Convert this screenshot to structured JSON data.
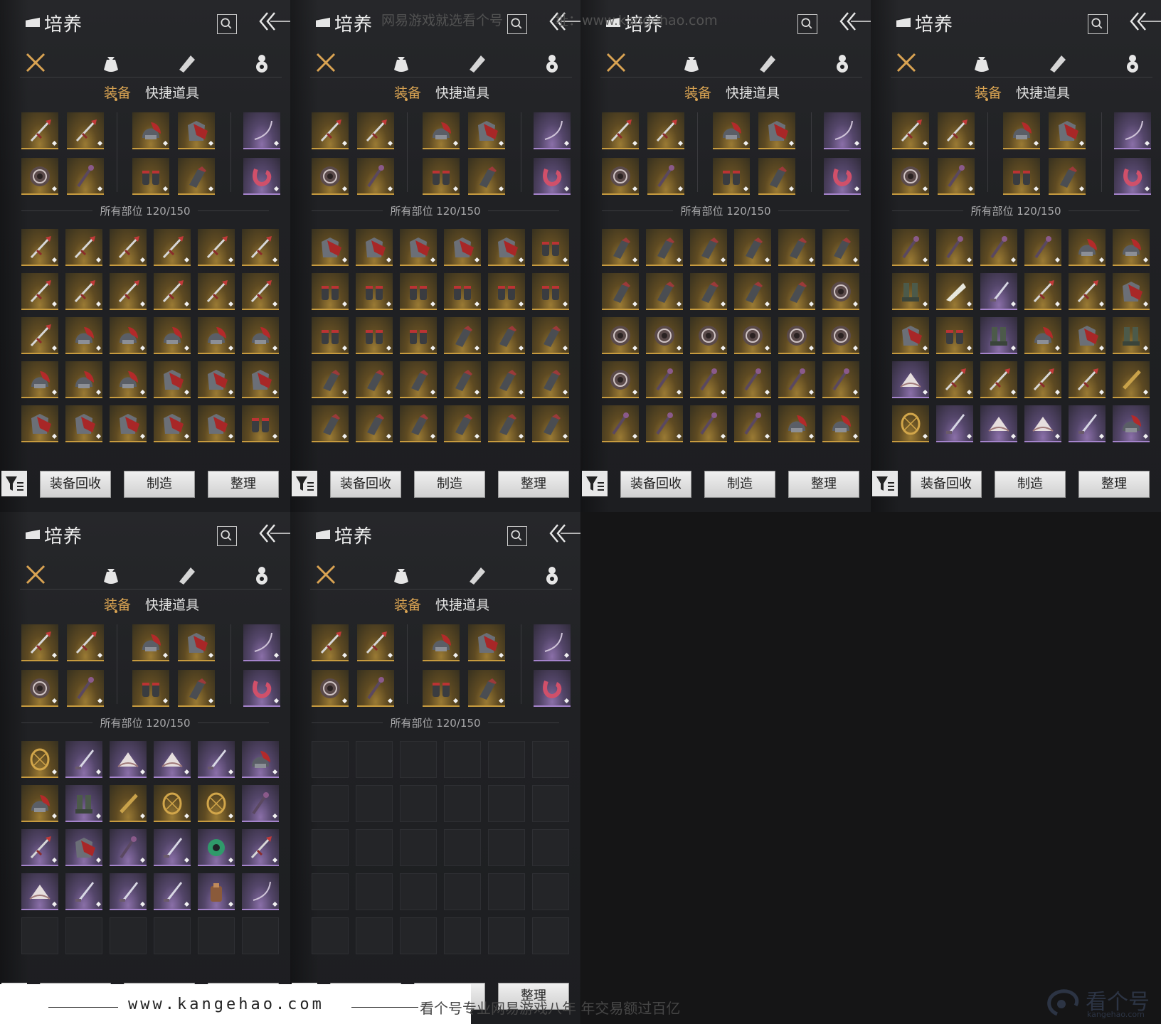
{
  "window_title": "培养",
  "sub_tabs": {
    "active": "装备",
    "inactive": "快捷道具"
  },
  "slot_count": "所有部位 120/150",
  "buttons": {
    "recycle": "装备回收",
    "craft": "制造",
    "sort": "整理"
  },
  "icons": {
    "categories": [
      "crossed-swords-icon",
      "pouch-icon",
      "scroll-icon",
      "gourd-icon"
    ],
    "search": "search-icon",
    "collapse": "collapse-arrow-icon",
    "filter": "filter-icon"
  },
  "top_watermark": {
    "left": "网易游戏就选看个号",
    "right": "址：www.kangehao.com"
  },
  "footer": {
    "url": "www.kangehao.com",
    "slogan": "看个号专业网易游戏八年   年交易额过百亿",
    "brand": "看个号",
    "brand_sub": "kangehao.com"
  },
  "colors": {
    "accent": "#d9a352",
    "gold_rarity": "#c79b3f",
    "purple_rarity": "#a584cc",
    "background": "#151516"
  },
  "panels": [
    {
      "id": "p1",
      "rows": [
        [
          "gold-spear",
          "gold-spear",
          "gold-spear",
          "gold-spear",
          "gold-spear",
          "gold-spear"
        ],
        [
          "gold-spear",
          "gold-spear",
          "gold-spear",
          "gold-spear",
          "gold-spear",
          "gold-spear"
        ],
        [
          "gold-spear",
          "gold-helmet",
          "gold-helmet",
          "gold-helmet",
          "gold-helmet",
          "gold-helmet"
        ],
        [
          "gold-helmet",
          "gold-helmet",
          "gold-helmet",
          "gold-armor",
          "gold-armor",
          "gold-armor"
        ],
        [
          "gold-armor",
          "gold-armor",
          "gold-armor",
          "gold-armor",
          "gold-armor",
          "gold-gloves"
        ]
      ]
    },
    {
      "id": "p2",
      "rows": [
        [
          "gold-armor",
          "gold-armor",
          "gold-armor",
          "gold-armor",
          "gold-armor",
          "gold-gloves"
        ],
        [
          "gold-gloves",
          "gold-gloves",
          "gold-gloves",
          "gold-gloves",
          "gold-gloves",
          "gold-gloves"
        ],
        [
          "gold-gloves",
          "gold-gloves",
          "gold-gloves",
          "gold-gauntlet",
          "gold-gauntlet",
          "gold-gauntlet"
        ],
        [
          "gold-gauntlet",
          "gold-gauntlet",
          "gold-gauntlet",
          "gold-gauntlet",
          "gold-gauntlet",
          "gold-gauntlet"
        ],
        [
          "gold-gauntlet",
          "gold-gauntlet",
          "gold-gauntlet",
          "gold-gauntlet",
          "gold-gauntlet",
          "gold-gauntlet"
        ]
      ]
    },
    {
      "id": "p3",
      "rows": [
        [
          "gold-gauntlet",
          "gold-gauntlet",
          "gold-gauntlet",
          "gold-gauntlet",
          "gold-gauntlet",
          "gold-gauntlet"
        ],
        [
          "gold-gauntlet",
          "gold-gauntlet",
          "gold-gauntlet",
          "gold-gauntlet",
          "gold-gauntlet",
          "gold-shield"
        ],
        [
          "gold-shield",
          "gold-shield",
          "gold-shield",
          "gold-shield",
          "gold-shield",
          "gold-shield"
        ],
        [
          "gold-shield",
          "gold-staff",
          "gold-staff",
          "gold-staff",
          "gold-staff",
          "gold-staff"
        ],
        [
          "gold-staff",
          "gold-staff",
          "gold-staff",
          "gold-staff",
          "gold-helmet",
          "gold-helmet"
        ]
      ]
    },
    {
      "id": "p4",
      "rows": [
        [
          "gold-staff",
          "gold-staff",
          "gold-staff",
          "gold-staff",
          "gold-helmet",
          "gold-helmet"
        ],
        [
          "gold-boots",
          "gold-horn",
          "purple-blade",
          "gold-spear",
          "gold-spear",
          "gold-armor"
        ],
        [
          "gold-armor",
          "gold-gloves",
          "purple-boots",
          "gold-helmet",
          "gold-armor",
          "gold-boots"
        ],
        [
          "purple-fan",
          "gold-spear",
          "gold-spear",
          "gold-spear",
          "gold-spear",
          "gold-flute"
        ],
        [
          "gold-ring",
          "purple-blade",
          "purple-fan",
          "purple-fan",
          "purple-blade",
          "purple-helmet"
        ]
      ]
    },
    {
      "id": "p5",
      "rows": [
        [
          "gold-ring",
          "purple-blade",
          "purple-fan",
          "purple-fan",
          "purple-blade",
          "purple-helmet"
        ],
        [
          "gold-helmet",
          "purple-boots",
          "gold-flute",
          "gold-ring",
          "gold-ring",
          "purple-staff"
        ],
        [
          "purple-spear",
          "purple-armor",
          "purple-staff",
          "purple-blade",
          "purple-jade",
          "purple-spear"
        ],
        [
          "purple-fan",
          "purple-blade",
          "purple-blade",
          "purple-blade",
          "purple-bag",
          "purple-bow"
        ],
        [
          "empty",
          "empty",
          "empty",
          "empty",
          "empty",
          "empty"
        ]
      ]
    },
    {
      "id": "p6",
      "rows": [
        [
          "empty",
          "empty",
          "empty",
          "empty",
          "empty",
          "empty"
        ],
        [
          "empty",
          "empty",
          "empty",
          "empty",
          "empty",
          "empty"
        ],
        [
          "empty",
          "empty",
          "empty",
          "empty",
          "empty",
          "empty"
        ],
        [
          "empty",
          "empty",
          "empty",
          "empty",
          "empty",
          "empty"
        ],
        [
          "empty",
          "empty",
          "empty",
          "empty",
          "empty",
          "empty"
        ]
      ]
    }
  ],
  "equipped": [
    [
      "gold-spear",
      "gold-spear",
      "gold-helmet",
      "gold-armor",
      "purple-bow"
    ],
    [
      "gold-shield",
      "gold-staff",
      "gold-gloves",
      "gold-gauntlet",
      "purple-scarf"
    ]
  ]
}
